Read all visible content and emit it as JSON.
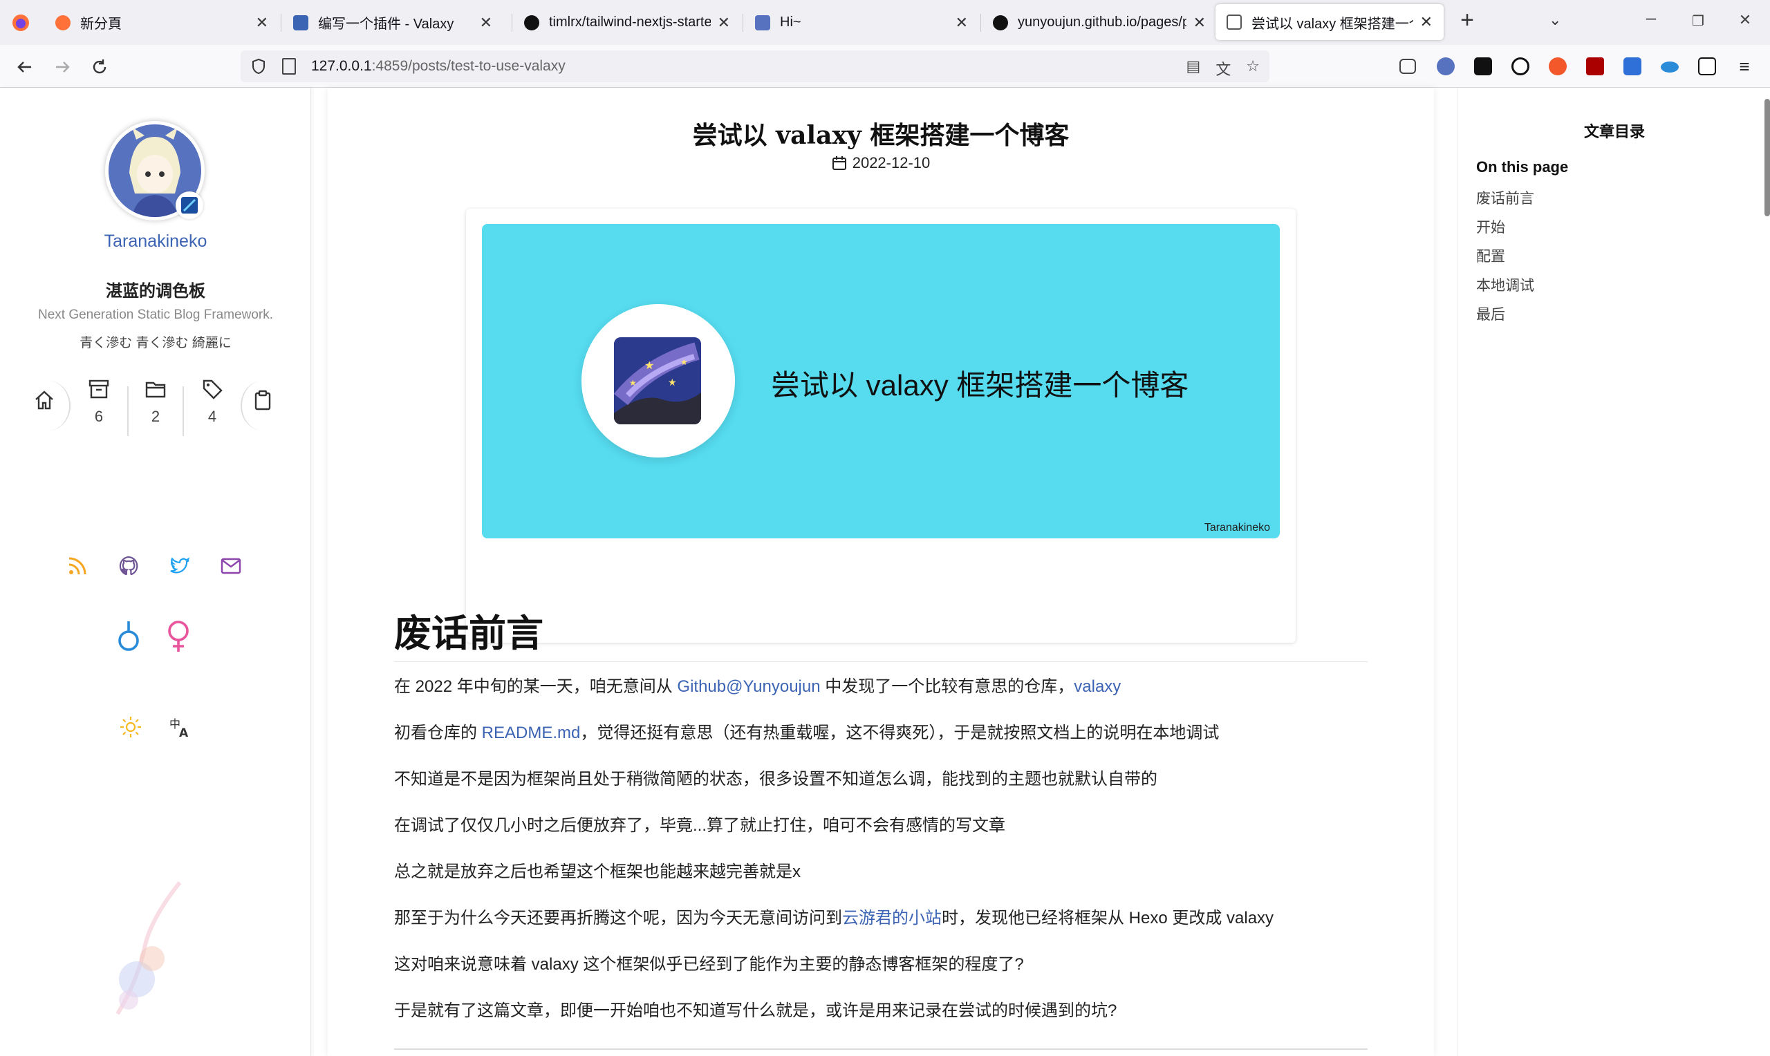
{
  "browser": {
    "tabs": [
      {
        "title": "新分頁",
        "fav_color": "#ff7139"
      },
      {
        "title": "编写一个插件 - Valaxy",
        "fav_color": "#3c64b4"
      },
      {
        "title": "timlrx/tailwind-nextjs-starter",
        "fav_color": "#111"
      },
      {
        "title": "Hi~",
        "fav_color": "#5773c0"
      },
      {
        "title": "yunyoujun.github.io/pages/p",
        "fav_color": "#111"
      },
      {
        "title": "尝试以 valaxy 框架搭建一个博客",
        "fav_color": "#555"
      }
    ],
    "new_tab": "+",
    "url_host": "127.0.0.1",
    "url_rest": ":4859/posts/test-to-use-valaxy"
  },
  "sidebar": {
    "author": "Taranakineko",
    "site_title": "湛蓝的调色板",
    "site_subtitle": "Next Generation Static Blog Framework.",
    "site_desc": "青く滲む 青く滲む 綺麗に",
    "stats": {
      "posts": "6",
      "categories": "2",
      "tags": "4"
    },
    "socials": [
      {
        "name": "rss-icon",
        "color": "#f5a623"
      },
      {
        "name": "github-icon",
        "color": "#6e5494"
      },
      {
        "name": "twitter-icon",
        "color": "#1da1f2"
      },
      {
        "name": "mail-icon",
        "color": "#8e44ad"
      }
    ],
    "male_symbol": "♂",
    "female_symbol": "♀"
  },
  "post": {
    "title": "尝试以 valaxy 框架搭建一个博客",
    "date": "2022-12-10",
    "cover_text": "尝试以 valaxy 框架搭建一个博客",
    "cover_author": "Taranakineko",
    "section_heading": "废话前言",
    "paragraphs": {
      "p1_a": "在 2022 年中旬的某一天，咱无意间从 ",
      "p1_link1": "Github@Yunyoujun",
      "p1_b": " 中发现了一个比较有意思的仓库，",
      "p1_link2": "valaxy",
      "p2_a": "初看仓库的 ",
      "p2_link": "README.md",
      "p2_b": "，觉得还挺有意思（还有热重载喔，这不得爽死），于是就按照文档上的说明在本地调试",
      "p3": "不知道是不是因为框架尚且处于稍微简陋的状态，很多设置不知道怎么调，能找到的主题也就默认自带的",
      "p4": "在调试了仅仅几小时之后便放弃了，毕竟...算了就止打住，咱可不会有感情的写文章",
      "p5": "总之就是放弃之后也希望这个框架也能越来越完善就是x",
      "p6_a": "那至于为什么今天还要再折腾这个呢，因为今天无意间访问到",
      "p6_link": "云游君的小站",
      "p6_b": "时，发现他已经将框架从 Hexo 更改成 valaxy",
      "p7": "这对咱来说意味着 valaxy 这个框架似乎已经到了能作为主要的静态博客框架的程度了?",
      "p8": "于是就有了这篇文章，即便一开始咱也不知道写什么就是，或许是用来记录在尝试的时候遇到的坑?"
    }
  },
  "toc": {
    "title": "文章目录",
    "heading": "On this page",
    "items": [
      "废话前言",
      "开始",
      "配置",
      "本地调试",
      "最后"
    ]
  },
  "colors": {
    "accent": "#3c64b4",
    "cover_bg": "#56dbef",
    "male": "#2a8bd8",
    "female": "#e8559c",
    "sun": "#f5b921"
  }
}
